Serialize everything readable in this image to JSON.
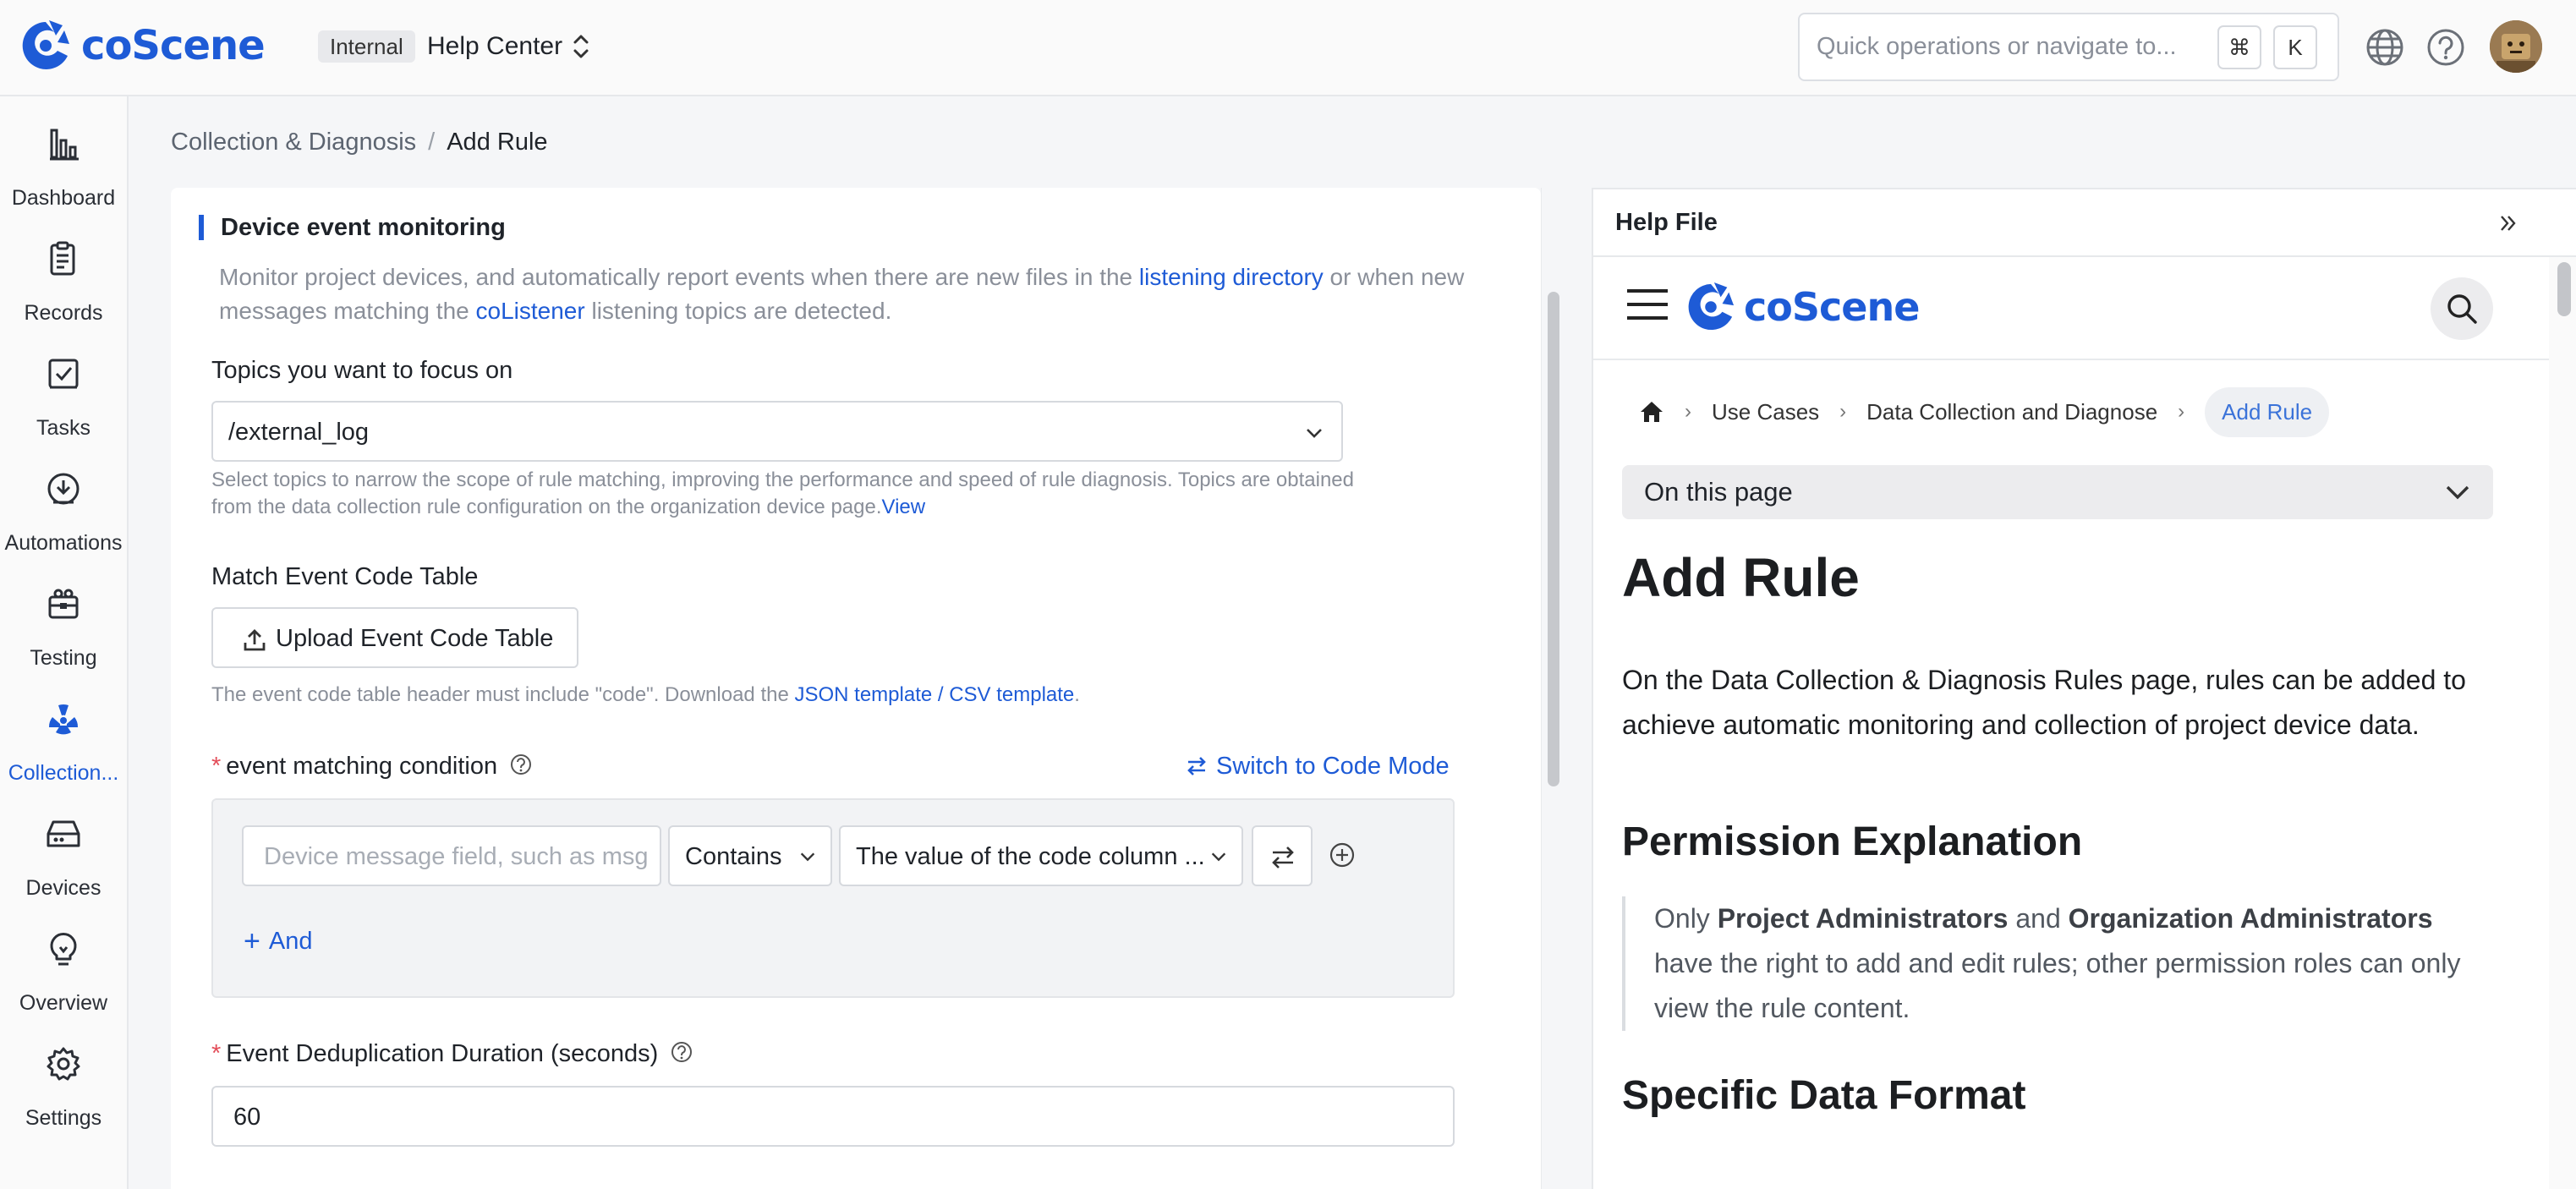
{
  "topbar": {
    "brand": "coScene",
    "org_badge": "Internal",
    "org_name": "Help Center",
    "search_placeholder": "Quick operations or navigate to...",
    "shortcut_cmd": "⌘",
    "shortcut_key": "K",
    "accent_color": "#1e5bd6"
  },
  "sidebar": {
    "items": [
      {
        "label": "Dashboard",
        "icon": "bar-chart-icon"
      },
      {
        "label": "Records",
        "icon": "clipboard-icon"
      },
      {
        "label": "Tasks",
        "icon": "task-check-icon"
      },
      {
        "label": "Automations",
        "icon": "automation-icon"
      },
      {
        "label": "Testing",
        "icon": "testing-icon"
      },
      {
        "label": "Collection...",
        "icon": "radiation-icon",
        "active": true
      },
      {
        "label": "Devices",
        "icon": "device-icon"
      },
      {
        "label": "Overview",
        "icon": "bulb-icon"
      },
      {
        "label": "Settings",
        "icon": "gear-icon"
      }
    ]
  },
  "breadcrumb": {
    "parent": "Collection & Diagnosis",
    "separator": "/",
    "current": "Add Rule"
  },
  "form": {
    "section_title": "Device event monitoring",
    "desc_1": "Monitor project devices, and automatically report events when there are new files in the ",
    "desc_link_1": "listening directory",
    "desc_2": " or when new messages matching the ",
    "desc_link_2": "coListener",
    "desc_3": " listening topics are detected.",
    "topics_label": "Topics you want to focus on",
    "topics_value": "/external_log",
    "topics_hint": "Select topics to narrow the scope of rule matching, improving the performance and speed of rule diagnosis. Topics are obtained from the data collection rule configuration on the organization device page.",
    "topics_hint_link": "View",
    "code_table_label": "Match Event Code Table",
    "upload_button": "Upload Event Code Table",
    "code_table_hint": "The event code table header must include \"code\". Download the ",
    "code_table_hint_link": "JSON template / CSV template",
    "code_table_hint_end": ".",
    "condition_label": "event matching condition",
    "switch_mode": "Switch to Code Mode",
    "field_placeholder": "Device message field, such as msg",
    "operator": "Contains",
    "value_select": "The value of the code column ...",
    "and_button": "And",
    "dedup_label": "Event Deduplication Duration (seconds)",
    "dedup_value": "60"
  },
  "help": {
    "title": "Help File",
    "brand": "coScene",
    "crumbs": [
      "Use Cases",
      "Data Collection and Diagnose",
      "Add Rule"
    ],
    "on_this_page": "On this page",
    "h1": "Add Rule",
    "intro": "On the Data Collection & Diagnosis Rules page, rules can be added to achieve automatic monitoring and collection of project device data.",
    "h2_permission": "Permission Explanation",
    "quote_1": "Only ",
    "quote_b1": "Project Administrators",
    "quote_2": " and ",
    "quote_b2": "Organization Administrators",
    "quote_3": " have the right to add and edit rules; other permission roles can only view the rule content.",
    "h2_format": "Specific Data Format"
  }
}
